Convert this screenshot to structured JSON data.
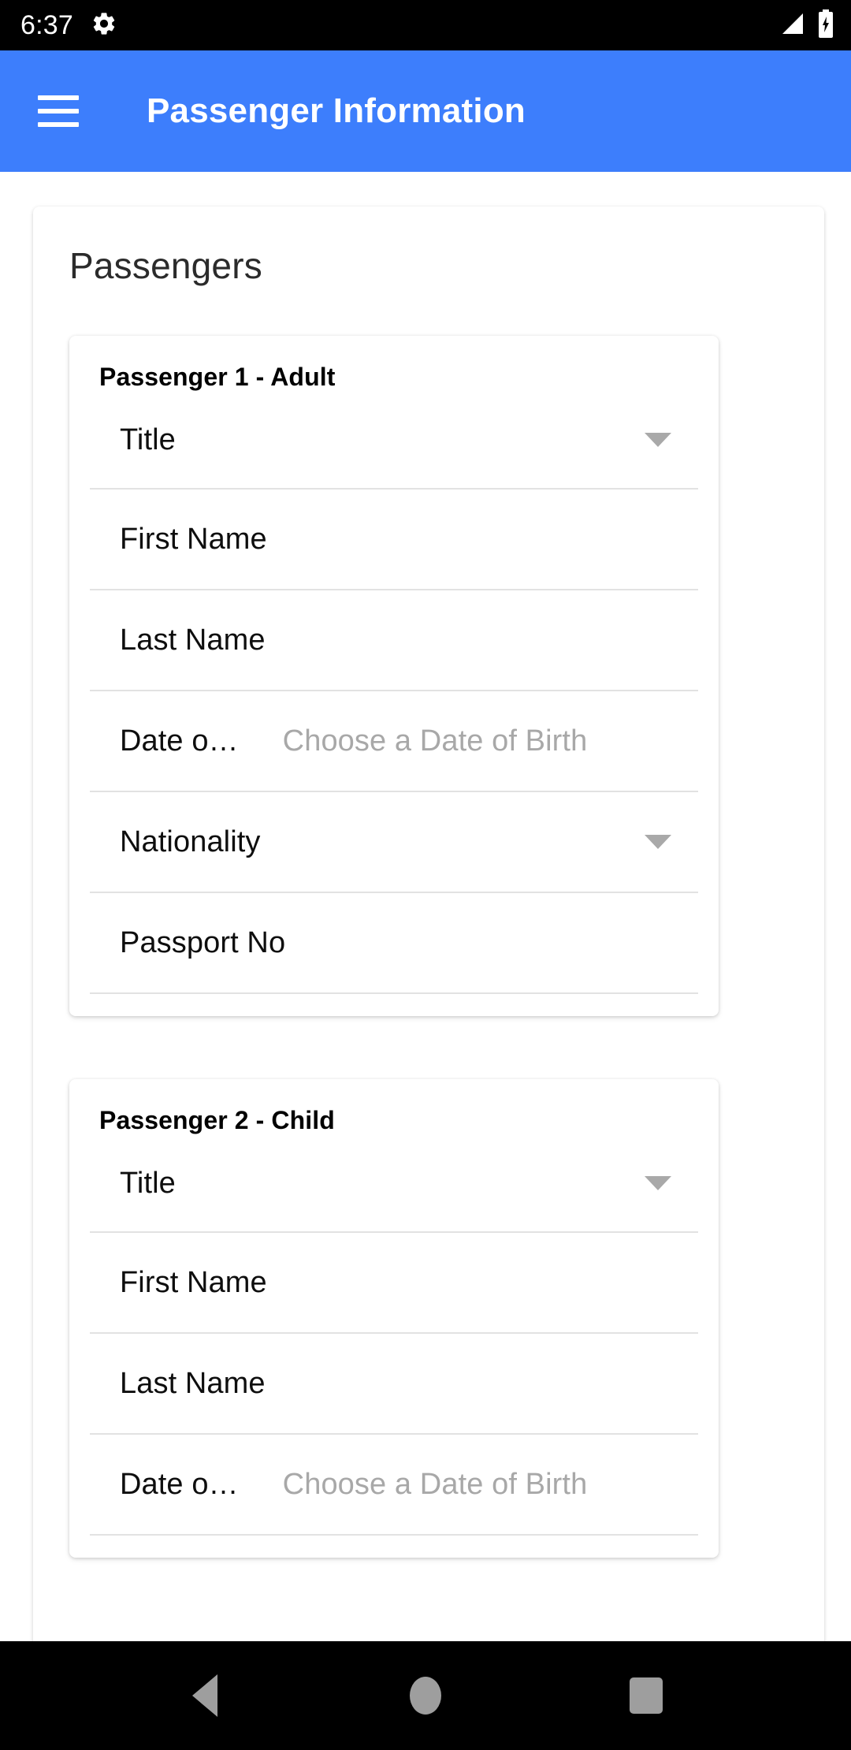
{
  "status_bar": {
    "time": "6:37",
    "icons": [
      "gear-icon",
      "signal-icon",
      "battery-charging-icon"
    ]
  },
  "app_bar": {
    "menu_icon": "hamburger-menu-icon",
    "title": "Passenger Information",
    "background_color": "#3d7efc",
    "text_color": "#ffffff"
  },
  "main": {
    "section_title": "Passengers",
    "passengers": [
      {
        "header": "Passenger 1 - Adult",
        "fields": [
          {
            "label": "Title",
            "type": "dropdown",
            "value": "",
            "placeholder": ""
          },
          {
            "label": "First Name",
            "type": "text",
            "value": "",
            "placeholder": ""
          },
          {
            "label": "Last Name",
            "type": "text",
            "value": "",
            "placeholder": ""
          },
          {
            "label": "Date o…",
            "type": "date",
            "value": "",
            "placeholder": "Choose a Date of Birth"
          },
          {
            "label": "Nationality",
            "type": "dropdown",
            "value": "",
            "placeholder": ""
          },
          {
            "label": "Passport No",
            "type": "text",
            "value": "",
            "placeholder": ""
          }
        ]
      },
      {
        "header": "Passenger 2 - Child",
        "fields": [
          {
            "label": "Title",
            "type": "dropdown",
            "value": "",
            "placeholder": ""
          },
          {
            "label": "First Name",
            "type": "text",
            "value": "",
            "placeholder": ""
          },
          {
            "label": "Last Name",
            "type": "text",
            "value": "",
            "placeholder": ""
          },
          {
            "label": "Date o…",
            "type": "date",
            "value": "",
            "placeholder": "Choose a Date of Birth"
          }
        ]
      }
    ]
  },
  "nav_bar": {
    "buttons": [
      {
        "name": "back-button",
        "icon": "triangle-back-icon"
      },
      {
        "name": "home-button",
        "icon": "circle-home-icon"
      },
      {
        "name": "recents-button",
        "icon": "square-recents-icon"
      }
    ],
    "icon_color": "#9e9e9e",
    "background_color": "#000000"
  }
}
